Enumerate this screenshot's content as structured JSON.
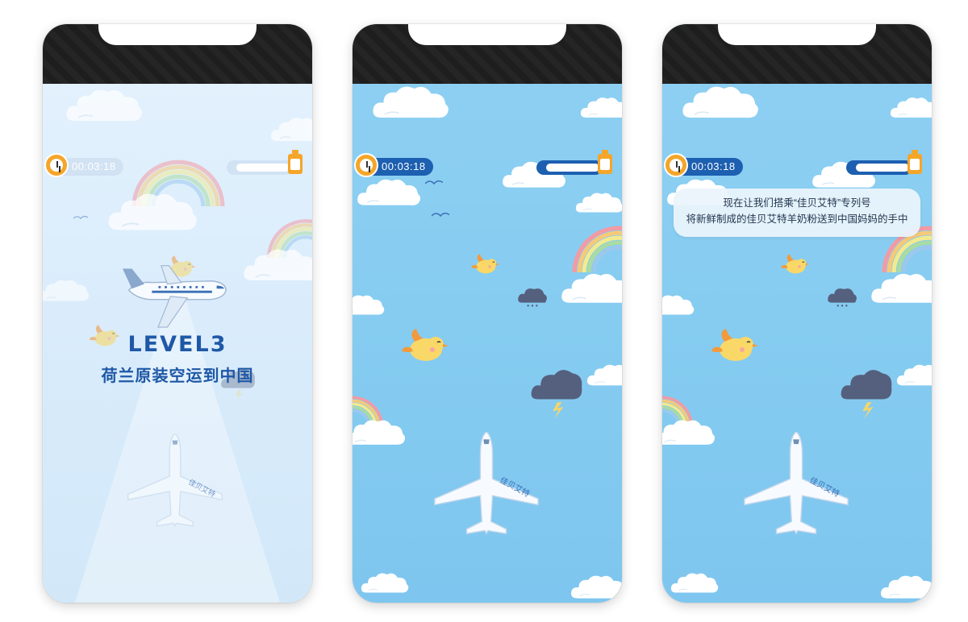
{
  "screens": [
    {
      "timer": {
        "value": "00:03:18"
      },
      "progress": 0.0,
      "level": {
        "title": "LEVEL3",
        "subtitle": "荷兰原装空运到中国"
      },
      "plane_brand": "佳贝艾特"
    },
    {
      "timer": {
        "value": "00:03:18"
      },
      "progress": 0.0,
      "plane_brand": "佳贝艾特"
    },
    {
      "timer": {
        "value": "00:03:18"
      },
      "progress": 0.0,
      "message": {
        "line1": "现在让我们搭乘“佳贝艾特”专列号",
        "line2": "将新鲜制成的佳贝艾特羊奶粉送到中国妈妈的手中"
      },
      "plane_brand": "佳贝艾特"
    }
  ],
  "icons": {
    "timer": "clock-icon",
    "progress_end": "milk-bottle-icon"
  },
  "colors": {
    "accent": "#1d5fb0",
    "clock": "#f4a62a",
    "bottle": "#f4a62a"
  }
}
